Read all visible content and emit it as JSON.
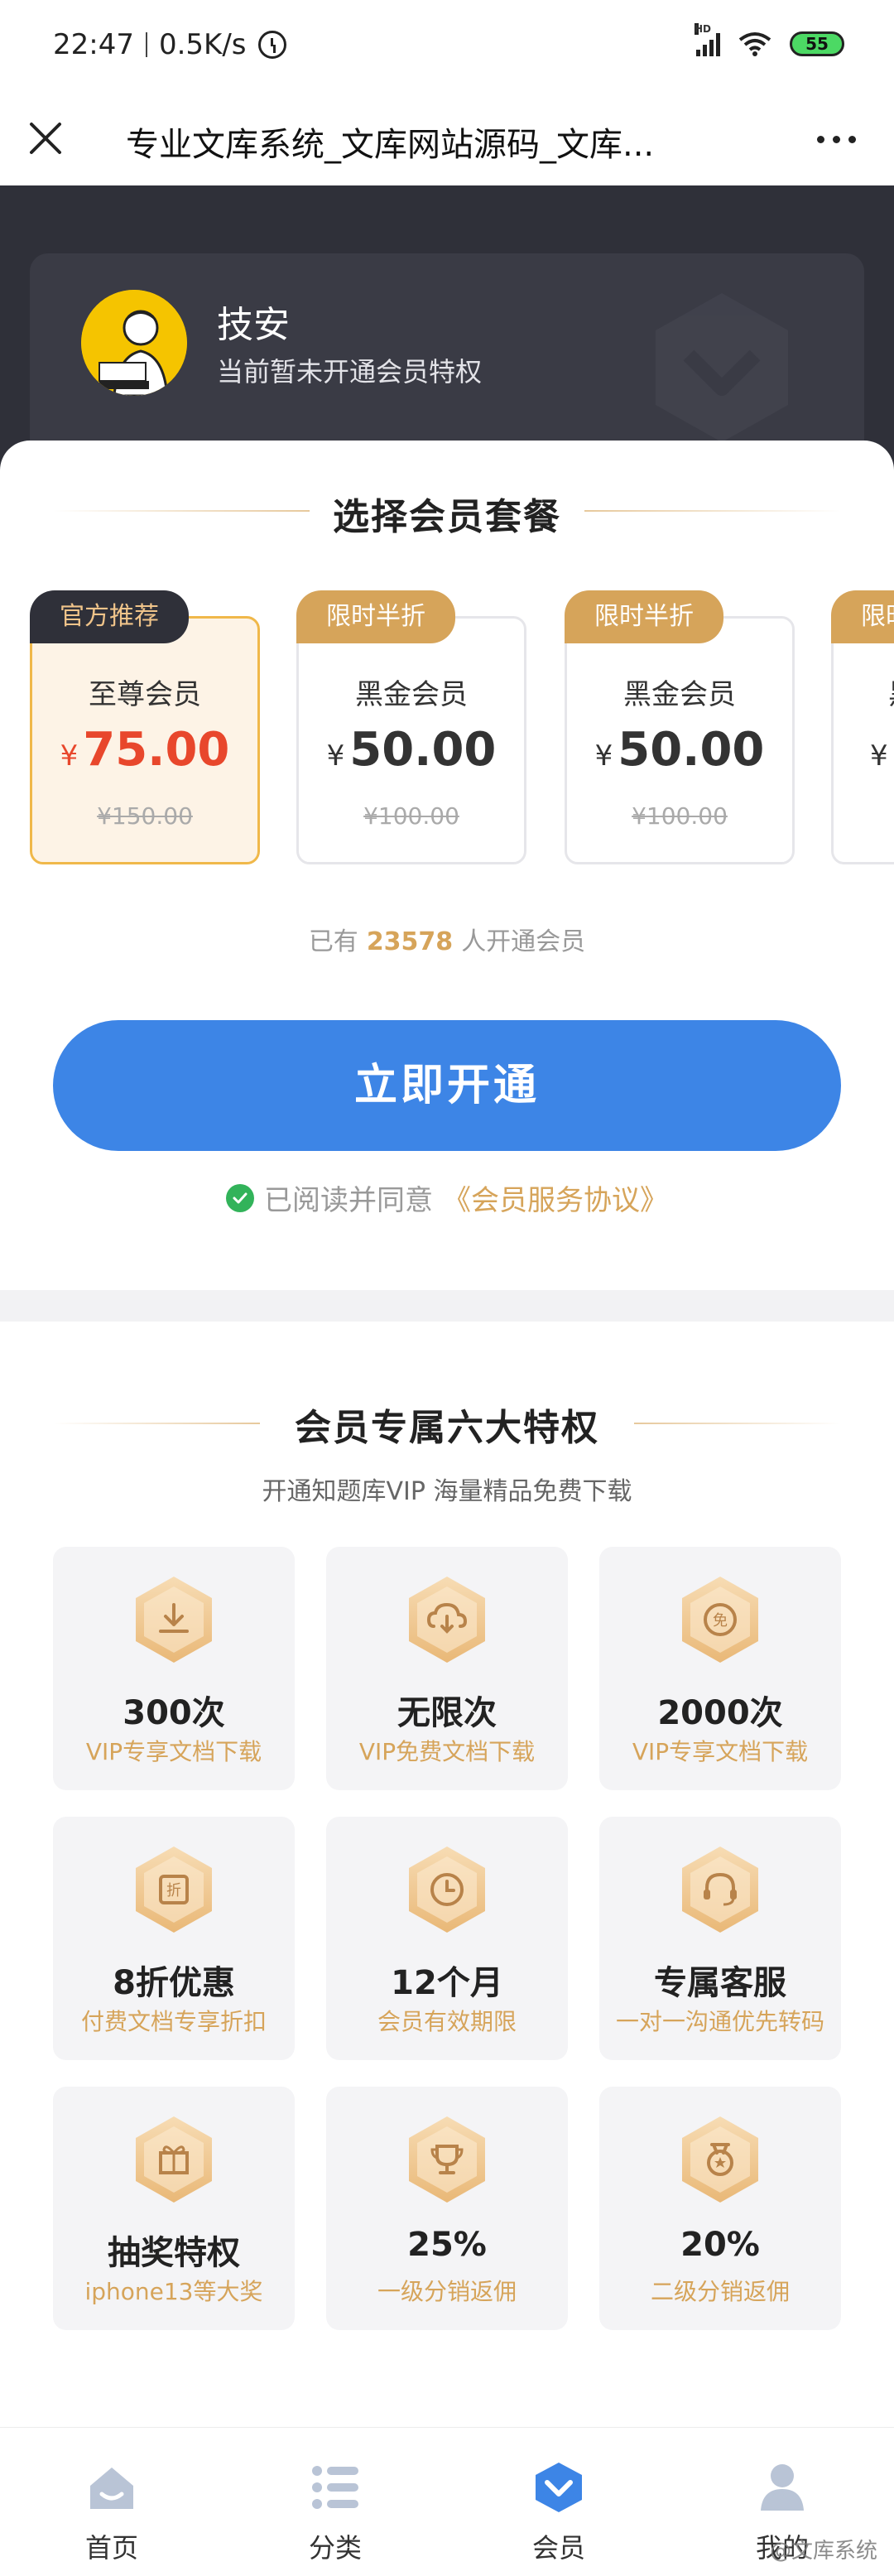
{
  "status_bar": {
    "time": "22:47",
    "speed": "0.5K/s",
    "battery": "55"
  },
  "title_bar": {
    "title": "专业文库系统_文库网站源码_文库..."
  },
  "user": {
    "name": "技安",
    "status": "当前暂未开通会员特权"
  },
  "plans": {
    "title": "选择会员套餐",
    "items": [
      {
        "badge": "官方推荐",
        "name": "至尊会员",
        "currency": "¥",
        "price": "75.00",
        "original": "¥150.00"
      },
      {
        "badge": "限时半折",
        "name": "黑金会员",
        "currency": "¥",
        "price": "50.00",
        "original": "¥100.00"
      },
      {
        "badge": "限时半折",
        "name": "黑金会员",
        "currency": "¥",
        "price": "50.00",
        "original": "¥100.00"
      },
      {
        "badge": "限时",
        "name": "黑",
        "currency": "¥",
        "price": "",
        "original": ""
      }
    ],
    "member_count_prefix": "已有",
    "member_count": "23578",
    "member_count_suffix": "人开通会员",
    "open_button": "立即开通",
    "agreement_text": "已阅读并同意",
    "agreement_link": "《会员服务协议》"
  },
  "privileges": {
    "title": "会员专属六大特权",
    "subtitle": "开通知题库VIP   海量精品免费下载",
    "items": [
      {
        "icon": "download-icon",
        "title": "300次",
        "desc": "VIP专享文档下载"
      },
      {
        "icon": "cloud-download-icon",
        "title": "无限次",
        "desc": "VIP免费文档下载"
      },
      {
        "icon": "free-icon",
        "title": "2000次",
        "desc": "VIP专享文档下载"
      },
      {
        "icon": "discount-icon",
        "title": "8折优惠",
        "desc": "付费文档专享折扣"
      },
      {
        "icon": "clock-icon",
        "title": "12个月",
        "desc": "会员有效期限"
      },
      {
        "icon": "headset-icon",
        "title": "专属客服",
        "desc": "一对一沟通优先转码"
      },
      {
        "icon": "gift-icon",
        "title": "抽奖特权",
        "desc": "iphone13等大奖"
      },
      {
        "icon": "trophy-icon",
        "title": "25%",
        "desc": "一级分销返佣"
      },
      {
        "icon": "medal-icon",
        "title": "20%",
        "desc": "二级分销返佣"
      }
    ]
  },
  "tabs": [
    {
      "icon": "home-icon",
      "label": "首页"
    },
    {
      "icon": "category-icon",
      "label": "分类"
    },
    {
      "icon": "vip-icon",
      "label": "会员"
    },
    {
      "icon": "user-icon",
      "label": "我的"
    }
  ],
  "watermark": "@文库系统",
  "colors": {
    "accent_blue": "#3d85e6",
    "gold": "#d6a45a",
    "price_red": "#e8472c",
    "dark": "#2f3039"
  }
}
